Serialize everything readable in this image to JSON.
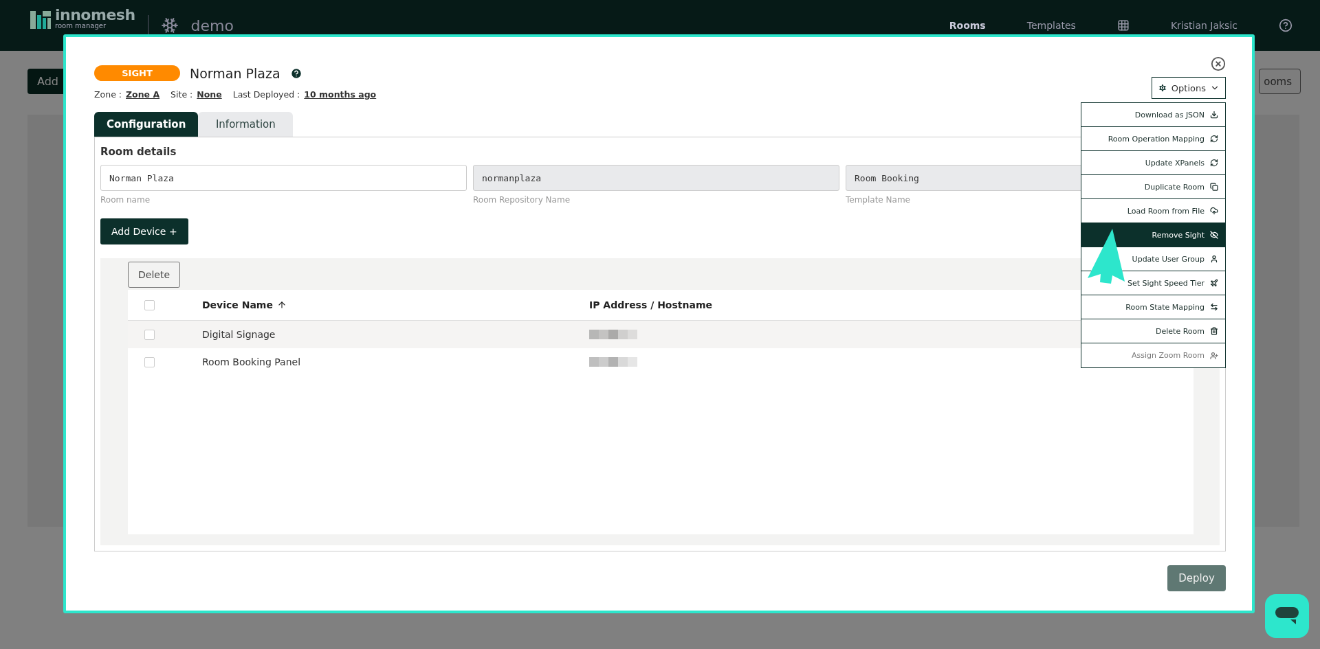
{
  "app_header": {
    "logo_text": "innomesh",
    "logo_subtext": "room manager",
    "tenant": "demo",
    "nav": [
      {
        "label": "Rooms",
        "selected": true
      },
      {
        "label": "Templates",
        "selected": false
      }
    ],
    "user": "Kristian Jaksic"
  },
  "background": {
    "left_button": "Add",
    "right_button": "ooms"
  },
  "modal": {
    "badge": "SIGHT",
    "title": "Norman Plaza",
    "meta": [
      {
        "label": "Zone :",
        "value": "Zone A"
      },
      {
        "label": "Site :",
        "value": "None"
      },
      {
        "label": "Last Deployed :",
        "value": "10 months ago"
      }
    ],
    "tabs": [
      {
        "label": "Configuration",
        "selected": true
      },
      {
        "label": "Information",
        "selected": false
      }
    ],
    "section_title": "Room details",
    "fields": [
      {
        "value": "Norman Plaza",
        "label": "Room name",
        "disabled": false
      },
      {
        "value": "normanplaza",
        "label": "Room Repository Name",
        "disabled": true
      },
      {
        "value": "Room Booking",
        "label": "Template Name",
        "disabled": true
      }
    ],
    "add_device_button": "Add Device +",
    "delete_button": "Delete",
    "table": {
      "columns": [
        "Device Name",
        "IP Address / Hostname"
      ],
      "header_checked": false,
      "rows": [
        {
          "name": "Digital Signage",
          "checked": false
        },
        {
          "name": "Room Booking Panel",
          "checked": false
        }
      ]
    },
    "options_button": "Options",
    "options_menu": [
      {
        "label": "Download as JSON",
        "selected": false,
        "disabled": false
      },
      {
        "label": "Room Operation Mapping",
        "selected": false,
        "disabled": false
      },
      {
        "label": "Update XPanels",
        "selected": false,
        "disabled": false
      },
      {
        "label": "Duplicate Room",
        "selected": false,
        "disabled": false
      },
      {
        "label": "Load Room from File",
        "selected": false,
        "disabled": false
      },
      {
        "label": "Remove Sight",
        "selected": true,
        "disabled": false
      },
      {
        "label": "Update User Group",
        "selected": false,
        "disabled": false
      },
      {
        "label": "Set Sight Speed Tier",
        "selected": false,
        "disabled": false
      },
      {
        "label": "Room State Mapping",
        "selected": false,
        "disabled": false
      },
      {
        "label": "Delete Room",
        "selected": false,
        "disabled": false
      },
      {
        "label": "Assign Zoom Room",
        "selected": false,
        "disabled": true
      }
    ],
    "deploy_button": "Deploy"
  }
}
